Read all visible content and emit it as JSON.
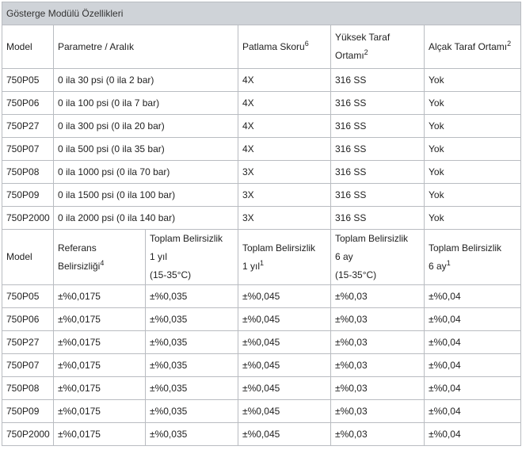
{
  "title": "Gösterge Modülü Özellikleri",
  "table1": {
    "headers": [
      {
        "lines": [
          "Model"
        ],
        "sup": ""
      },
      {
        "lines": [
          "Parametre / Aralık"
        ],
        "sup": ""
      },
      {
        "lines": [
          "Patlama Skoru"
        ],
        "sup": "6"
      },
      {
        "lines": [
          "Yüksek Taraf",
          "Ortamı"
        ],
        "sup": "2"
      },
      {
        "lines": [
          "Alçak Taraf Ortamı"
        ],
        "sup": "2"
      }
    ],
    "rows": [
      [
        "750P05",
        "0 ila 30 psi (0 ila 2 bar)",
        "4X",
        "316 SS",
        "Yok"
      ],
      [
        "750P06",
        "0 ila 100 psi (0 ila 7 bar)",
        "4X",
        "316 SS",
        "Yok"
      ],
      [
        "750P27",
        "0 ila 300 psi (0 ila 20 bar)",
        "4X",
        "316 SS",
        "Yok"
      ],
      [
        "750P07",
        "0 ila 500 psi (0 ila 35 bar)",
        "4X",
        "316 SS",
        "Yok"
      ],
      [
        "750P08",
        "0 ila 1000 psi (0 ila 70 bar)",
        "3X",
        "316 SS",
        "Yok"
      ],
      [
        "750P09",
        "0 ila 1500 psi (0 ila 100 bar)",
        "3X",
        "316 SS",
        "Yok"
      ],
      [
        "750P2000",
        "0 ila 2000 psi (0 ila 140 bar)",
        "3X",
        "316 SS",
        "Yok"
      ]
    ]
  },
  "table2": {
    "headers": [
      {
        "lines": [
          "Model"
        ],
        "sup": ""
      },
      {
        "lines": [
          "Referans",
          "Belirsizliği"
        ],
        "sup": "4"
      },
      {
        "lines": [
          "Toplam Belirsizlik",
          "1 yıl",
          "(15-35°C)"
        ],
        "sup": ""
      },
      {
        "lines": [
          "Toplam Belirsizlik",
          "1 yıl"
        ],
        "sup": "1"
      },
      {
        "lines": [
          "Toplam Belirsizlik",
          "6 ay",
          "(15-35°C)"
        ],
        "sup": ""
      },
      {
        "lines": [
          "Toplam Belirsizlik",
          "6 ay"
        ],
        "sup": "1"
      }
    ],
    "rows": [
      [
        "750P05",
        "±%0,0175",
        "±%0,035",
        "±%0,045",
        "±%0,03",
        "±%0,04"
      ],
      [
        "750P06",
        "±%0,0175",
        "±%0,035",
        "±%0,045",
        "±%0,03",
        "±%0,04"
      ],
      [
        "750P27",
        "±%0,0175",
        "±%0,035",
        "±%0,045",
        "±%0,03",
        "±%0,04"
      ],
      [
        "750P07",
        "±%0,0175",
        "±%0,035",
        "±%0,045",
        "±%0,03",
        "±%0,04"
      ],
      [
        "750P08",
        "±%0,0175",
        "±%0,035",
        "±%0,045",
        "±%0,03",
        "±%0,04"
      ],
      [
        "750P09",
        "±%0,0175",
        "±%0,035",
        "±%0,045",
        "±%0,03",
        "±%0,04"
      ],
      [
        "750P2000",
        "±%0,0175",
        "±%0,035",
        "±%0,045",
        "±%0,03",
        "±%0,04"
      ]
    ]
  }
}
